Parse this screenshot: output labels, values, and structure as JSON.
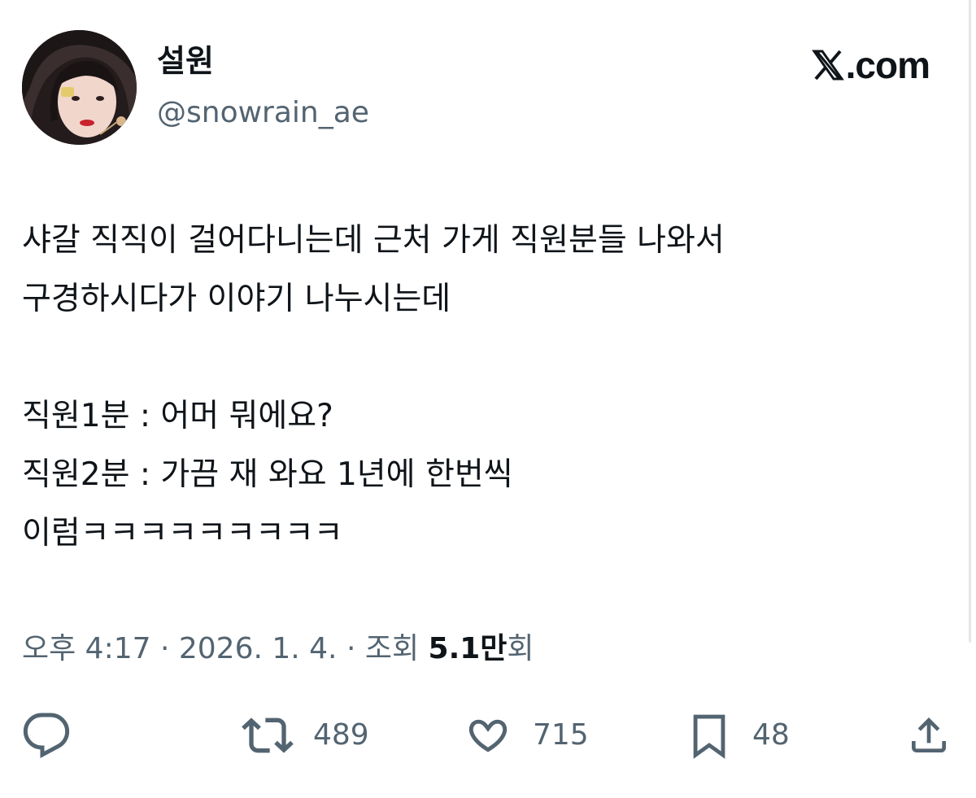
{
  "brand": {
    "label": ".com",
    "icon": "x-logo-icon"
  },
  "author": {
    "display_name": "설원",
    "handle": "@snowrain_ae",
    "avatar_icon": "avatar-photo"
  },
  "tweet": {
    "lines": [
      "샤갈 직직이 걸어다니는데 근처 가게 직원분들 나와서",
      "구경하시다가 이야기 나누시는데",
      "",
      "직원1분 : 어머 뭐에요?",
      "직원2분 : 가끔 재 와요 1년에 한번씩",
      "이럼ㅋㅋㅋㅋㅋㅋㅋㅋㅋ"
    ]
  },
  "meta": {
    "timestamp": "오후 4:17 · 2026. 1. 4. · 조회 ",
    "views_count": "5.1만",
    "views_unit": "회"
  },
  "actions": {
    "reply": {
      "icon": "reply-icon",
      "count": ""
    },
    "retweet": {
      "icon": "retweet-icon",
      "count": "489"
    },
    "like": {
      "icon": "heart-icon",
      "count": "715"
    },
    "bookmark": {
      "icon": "bookmark-icon",
      "count": "48"
    },
    "share": {
      "icon": "share-icon",
      "count": ""
    }
  },
  "colors": {
    "text_primary": "#0f1419",
    "text_secondary": "#536471",
    "background": "#ffffff"
  }
}
